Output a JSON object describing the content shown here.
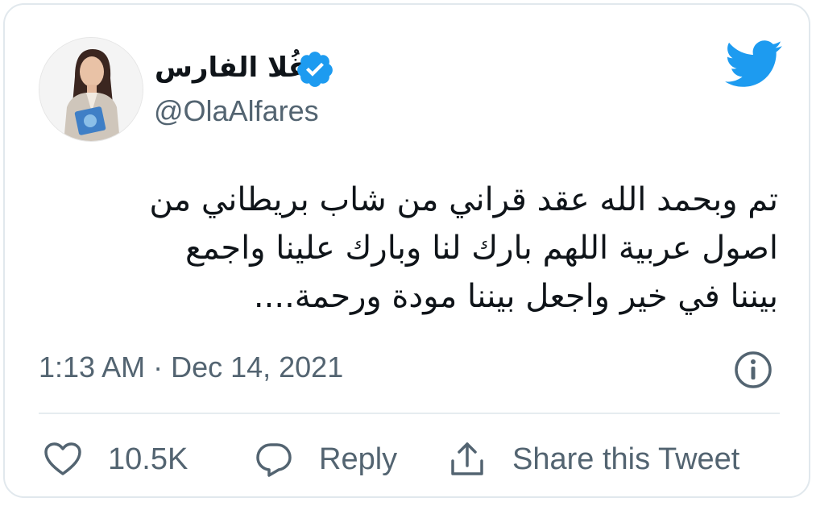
{
  "author": {
    "display_name": "غُلا الفارس",
    "handle": "@OlaAlfares",
    "verified": true
  },
  "tweet": {
    "lines": [
      "تم وبحمد الله عقد قراني  من شاب بريطاني من",
      "اصول عربية اللهم بارك لنا وبارك علينا واجمع",
      "بيننا في خير واجعل بيننا مودة ورحمة...."
    ],
    "timestamp": "1:13 AM · Dec 14, 2021"
  },
  "actions": {
    "likes_count": "10.5K",
    "reply_label": "Reply",
    "share_label": "Share this Tweet"
  },
  "colors": {
    "brand_blue": "#1d9bf0",
    "secondary_text": "#536471",
    "primary_text": "#0f1419",
    "border": "#e1e8ed"
  },
  "icons": [
    "verified-badge-icon",
    "twitter-bird-icon",
    "info-icon",
    "heart-icon",
    "reply-bubble-icon",
    "share-icon"
  ]
}
